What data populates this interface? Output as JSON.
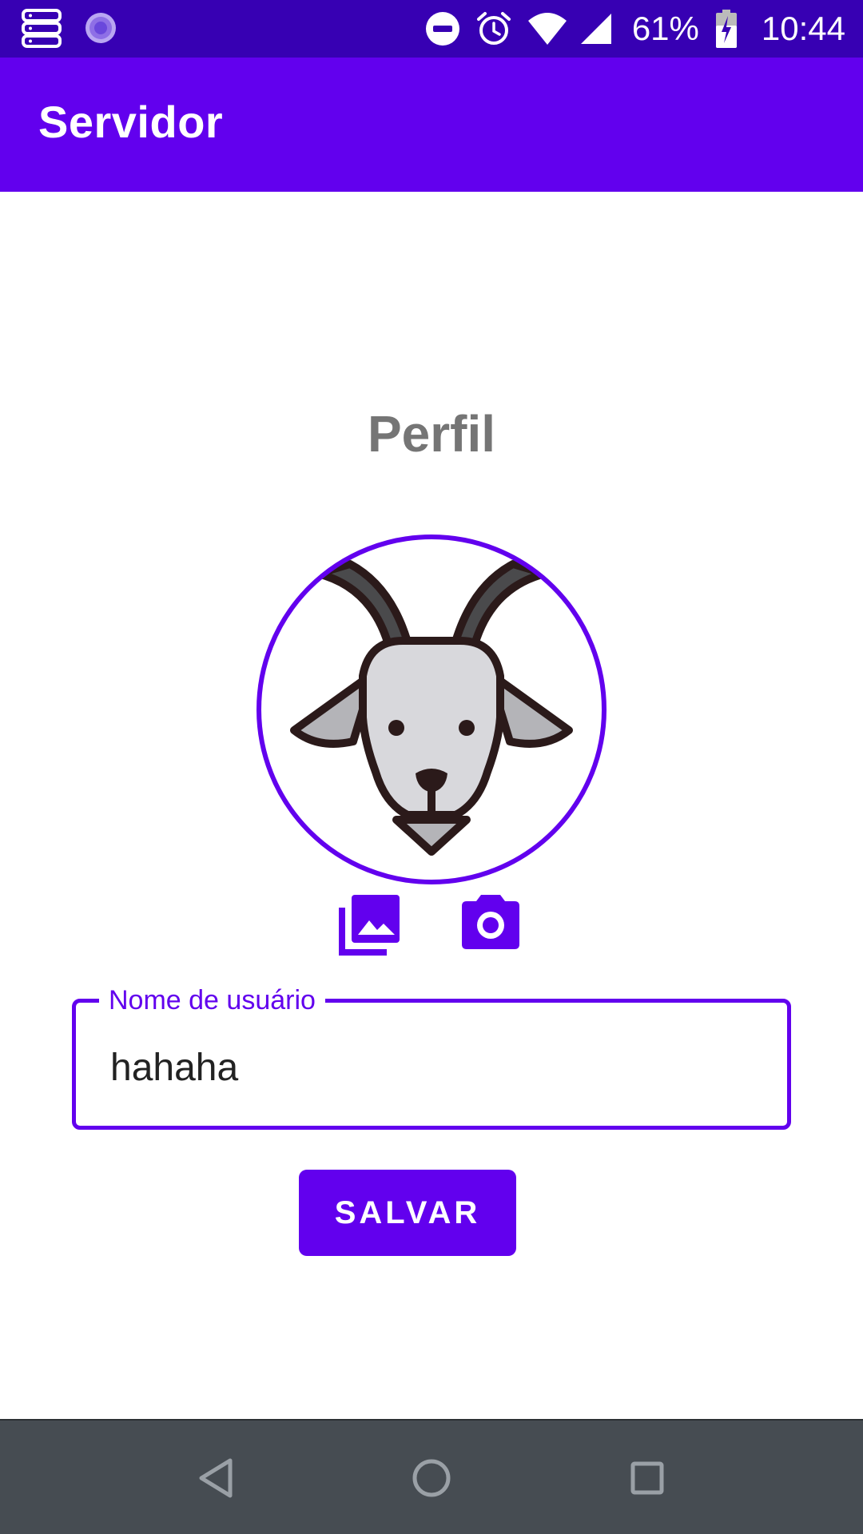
{
  "status_bar": {
    "battery": "61%",
    "time": "10:44",
    "icons": [
      "server-stack-icon",
      "loading-icon",
      "do-not-disturb-icon",
      "alarm-icon",
      "wifi-icon",
      "signal-icon",
      "battery-charging-icon"
    ]
  },
  "app_bar": {
    "title": "Servidor"
  },
  "profile": {
    "title": "Perfil",
    "avatar_icon": "goat-icon",
    "gallery_icon": "gallery-icon",
    "camera_icon": "camera-icon"
  },
  "username_field": {
    "label": "Nome de usuário",
    "value": "hahaha"
  },
  "save_button": {
    "label": "SALVAR"
  },
  "nav_bar": {
    "icons": [
      "back-icon",
      "home-icon",
      "recents-icon"
    ]
  },
  "colors": {
    "primary": "#6200EE",
    "primary_dark": "#3700B3",
    "nav": "#464C52",
    "title_gray": "#757575"
  }
}
